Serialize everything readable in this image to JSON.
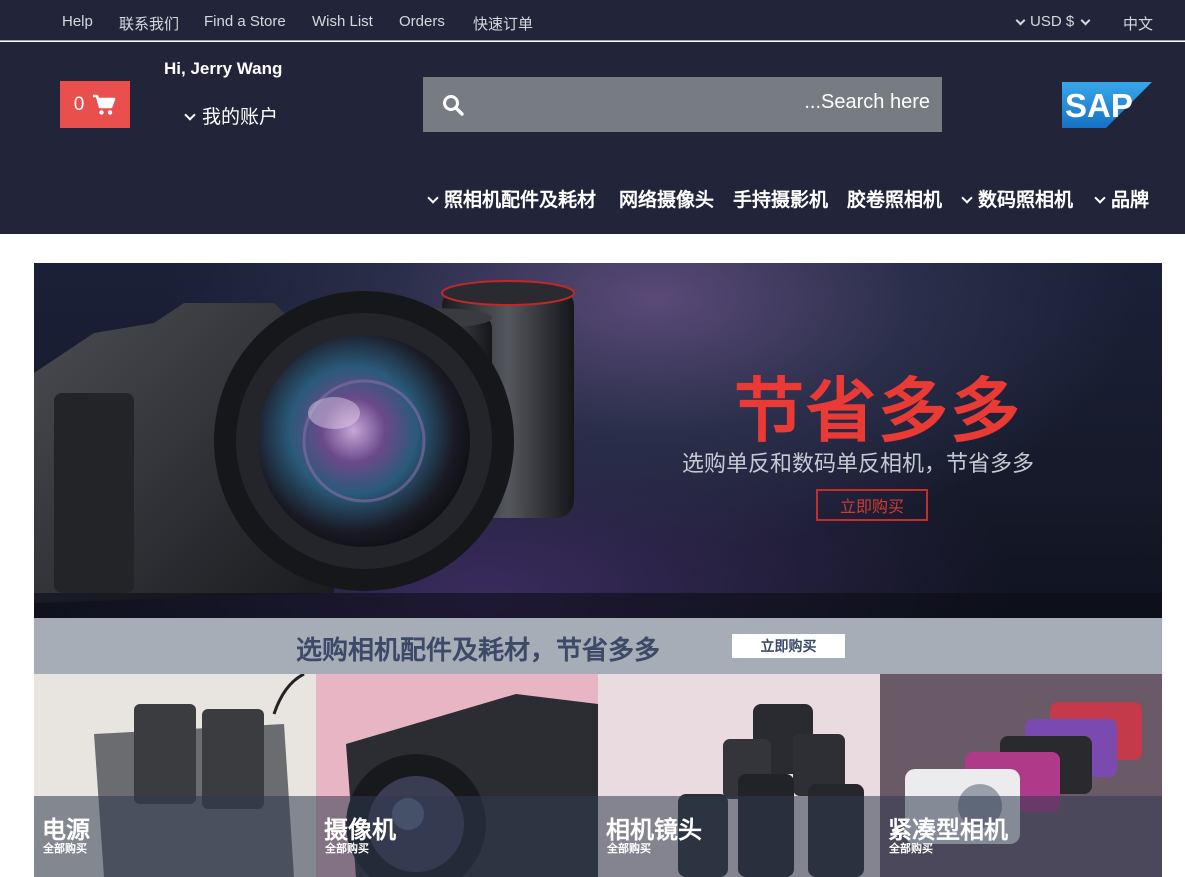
{
  "topbar": {
    "links": [
      "Help",
      "联系我们",
      "Find a Store",
      "Wish List",
      "Orders",
      "快速订单"
    ],
    "currency": "USD $",
    "language": "中文"
  },
  "header": {
    "cart_count": "0",
    "greeting": "Hi, Jerry Wang",
    "account_label": "我的账户",
    "search_placeholder": "...Search here",
    "logo_text": "SAP"
  },
  "nav": {
    "items": [
      "照相机配件及耗材",
      "网络摄像头",
      "手持摄影机",
      "胶卷照相机",
      "数码照相机",
      "品牌"
    ]
  },
  "hero": {
    "title": "节省多多",
    "subtitle": "选购单反和数码单反相机，节省多多",
    "button": "立即购买"
  },
  "promo": {
    "text": "选购相机配件及耗材，节省多多",
    "button": "立即购买"
  },
  "tiles": [
    {
      "name": "电源",
      "link": "全部购买"
    },
    {
      "name": "摄像机",
      "link": "全部购买"
    },
    {
      "name": "相机镜头",
      "link": "全部购买"
    },
    {
      "name": "紧凑型相机",
      "link": "全部购买"
    }
  ],
  "colors": {
    "header_bg": "#22253a",
    "cart_bg": "#e9504d",
    "hero_title": "#e93a35",
    "promo_bg": "#a6adb7",
    "search_bg": "#777b82"
  }
}
